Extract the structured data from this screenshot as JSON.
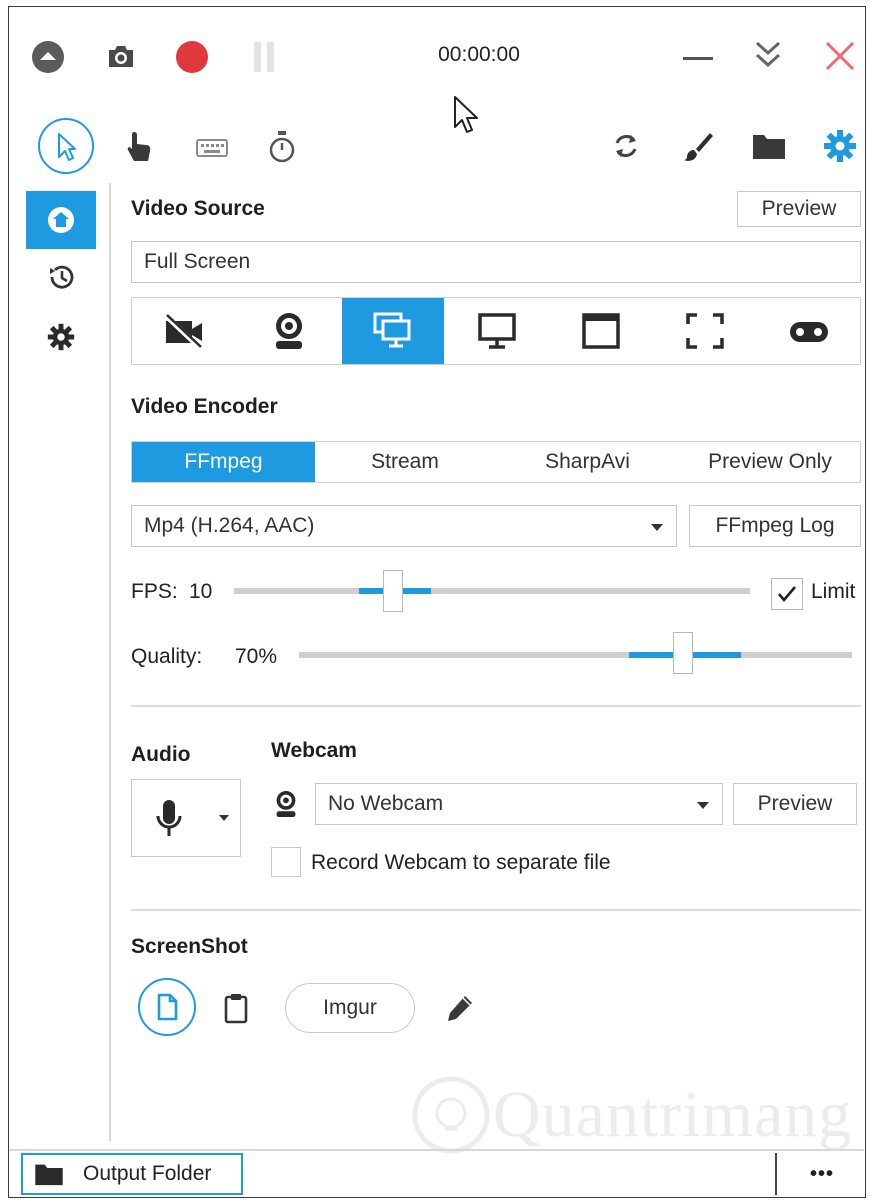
{
  "titlebar": {
    "timer": "00:00:00"
  },
  "sidebar": {
    "items": [
      {
        "icon": "home-icon",
        "active": true
      },
      {
        "icon": "history-icon"
      },
      {
        "icon": "settings-icon"
      }
    ]
  },
  "video_source": {
    "heading": "Video Source",
    "preview_label": "Preview",
    "value": "Full Screen",
    "sources": [
      "no-video-icon",
      "webcam-icon",
      "screen-icon",
      "monitor-icon",
      "window-icon",
      "region-icon",
      "gamepad-icon"
    ],
    "selected_index": 2
  },
  "video_encoder": {
    "heading": "Video Encoder",
    "tabs": [
      "FFmpeg",
      "Stream",
      "SharpAvi",
      "Preview Only"
    ],
    "selected_tab": 0,
    "format": "Mp4 (H.264, AAC)",
    "log_label": "FFmpeg Log"
  },
  "fps": {
    "label": "FPS:",
    "value": "10",
    "limit_label": "Limit",
    "limit_checked": true
  },
  "quality": {
    "label": "Quality:",
    "value": "70%"
  },
  "audio": {
    "heading": "Audio"
  },
  "webcam": {
    "heading": "Webcam",
    "selected": "No Webcam",
    "preview_label": "Preview",
    "separate_file_label": "Record Webcam to separate file",
    "separate_file_checked": false
  },
  "screenshot": {
    "heading": "ScreenShot",
    "imgur_label": "Imgur"
  },
  "footer": {
    "output_folder_label": "Output Folder",
    "more_label": "•••"
  },
  "watermark": "Quantrimang",
  "colors": {
    "accent": "#1e9be0",
    "record": "#e0383c",
    "close": "#f06a6a"
  }
}
